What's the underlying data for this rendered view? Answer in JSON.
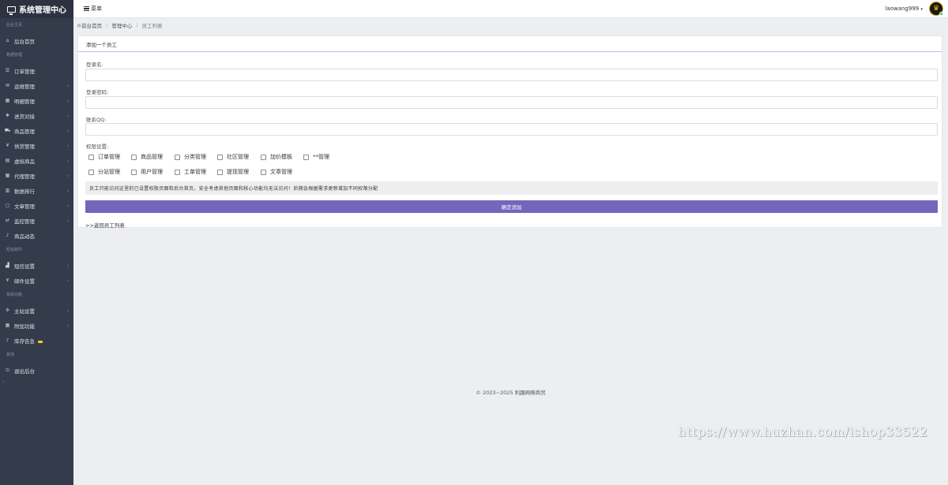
{
  "brand": {
    "title": "系统管理中心"
  },
  "sidebar": {
    "sections": [
      {
        "title": "后台主页",
        "items": [
          {
            "label": "后台首页",
            "icon": "home-icon",
            "glyph": "⌂",
            "chevron": false
          }
        ]
      },
      {
        "title": "数据管理",
        "items": [
          {
            "label": "订单管理",
            "icon": "list-icon",
            "glyph": "☰",
            "chevron": false
          },
          {
            "label": "运维管理",
            "icon": "comments-icon",
            "glyph": "✉",
            "chevron": true
          },
          {
            "label": "明细管理",
            "icon": "calendar-icon",
            "glyph": "▦",
            "chevron": true
          },
          {
            "label": "进货对接",
            "icon": "cubes-icon",
            "glyph": "❖",
            "chevron": true
          },
          {
            "label": "商品管理",
            "icon": "cart-icon",
            "glyph": "⛟",
            "chevron": true
          },
          {
            "label": "供货管理",
            "icon": "cutlery-icon",
            "glyph": "¥",
            "chevron": true
          },
          {
            "label": "虚拟商品",
            "icon": "grid-icon",
            "glyph": "▤",
            "chevron": true
          },
          {
            "label": "代理管理",
            "icon": "calendar-icon",
            "glyph": "▦",
            "chevron": true
          },
          {
            "label": "数据排行",
            "icon": "chart-icon",
            "glyph": "▥",
            "chevron": true
          },
          {
            "label": "文章管理",
            "icon": "file-icon",
            "glyph": "▢",
            "chevron": true
          },
          {
            "label": "监控管理",
            "icon": "exchange-icon",
            "glyph": "⇄",
            "chevron": true
          },
          {
            "label": "商品动态",
            "icon": "bell-icon",
            "glyph": "♪",
            "chevron": false
          }
        ]
      },
      {
        "title": "短信邮件",
        "items": [
          {
            "label": "短信设置",
            "icon": "bar-chart-icon",
            "glyph": "▟",
            "chevron": true
          },
          {
            "label": "邮件设置",
            "icon": "cutlery-icon",
            "glyph": "¥",
            "chevron": true
          }
        ]
      },
      {
        "title": "系统功能",
        "items": [
          {
            "label": "主站设置",
            "icon": "gear-icon",
            "glyph": "✲",
            "chevron": true
          },
          {
            "label": "附加功能",
            "icon": "calendar-icon",
            "glyph": "▦",
            "chevron": true
          },
          {
            "label": "库存告急",
            "icon": "bell-icon",
            "glyph": "♪",
            "chevron": false,
            "badge": true
          }
        ]
      },
      {
        "title": "其他",
        "items": [
          {
            "label": "退出后台",
            "icon": "power-icon",
            "glyph": "⏻",
            "chevron": false
          }
        ]
      }
    ],
    "collapse_glyph": "‹"
  },
  "topbar": {
    "menu_label": "菜单",
    "username": "laowang999",
    "user_caret": "▾",
    "avatar_glyph": "♛"
  },
  "breadcrumb": {
    "home_icon": "⌂",
    "items": [
      "前台首页",
      "管理中心",
      "员工列表"
    ],
    "separator": "/"
  },
  "panel": {
    "title": "添加一个员工",
    "fields": [
      {
        "label": "登录名:",
        "value": ""
      },
      {
        "label": "登录密码:",
        "value": ""
      },
      {
        "label": "联系QQ:",
        "value": ""
      }
    ],
    "permissions_label": "权限设置:",
    "permissions_row1": [
      "订单管理",
      "商品管理",
      "分类管理",
      "社区管理",
      "加价模板",
      "**管理"
    ],
    "permissions_row2": [
      "分站管理",
      "用户管理",
      "工单管理",
      "提现管理",
      "文章管理"
    ],
    "notice": "员工只能访问这里的已设置权限页面和后台首页，安全考虑其他页面和核心功能均无法访问！后期会根据需求更新增加不同权限分配",
    "submit_label": "确定添加",
    "back_link": ">>返回员工列表"
  },
  "footer": {
    "text": "© 2023~2025 利趣网络商贸"
  },
  "watermark": {
    "text": "https://www.huzhan.com/ishop33522"
  },
  "colors": {
    "sidebar_bg": "#343b4b",
    "accent": "#7366bd",
    "badge": "#f4d21d"
  }
}
